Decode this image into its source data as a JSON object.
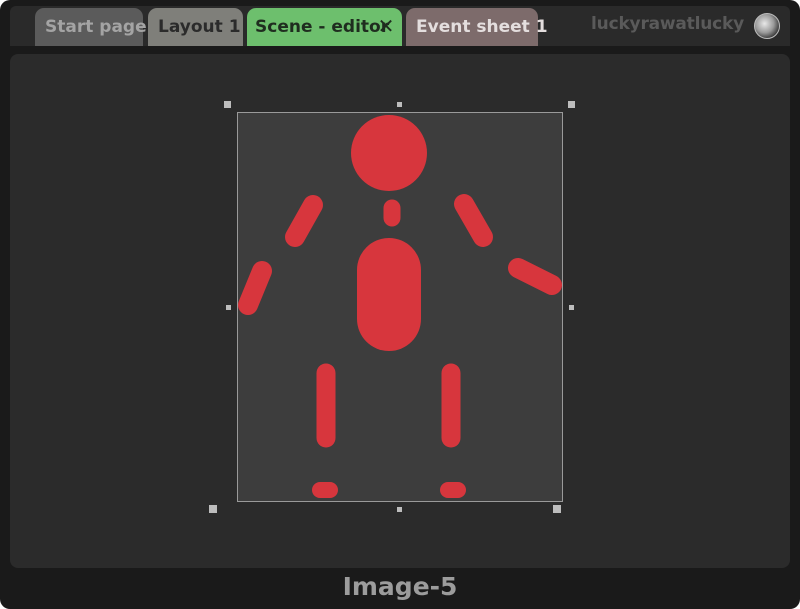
{
  "tabs": [
    {
      "label": "Start page",
      "active": false
    },
    {
      "label": "Layout 1",
      "active": false
    },
    {
      "label": "Scene - editor",
      "active": true
    },
    {
      "label": "Event sheet 1",
      "active": false
    }
  ],
  "tab_close_icon": "close-icon",
  "user": {
    "name": "luckyrawatlucky",
    "avatar_icon": "user-avatar"
  },
  "figure": {
    "color": "#d7363d",
    "name": "stick-figure"
  },
  "footer": {
    "title": "Image-5"
  },
  "colors": {
    "active_tab": "#6dbf6d",
    "event_tab": "#7d6b6b",
    "canvas_bg": "#2b2b2b",
    "stage_bg": "#3d3d3d"
  }
}
